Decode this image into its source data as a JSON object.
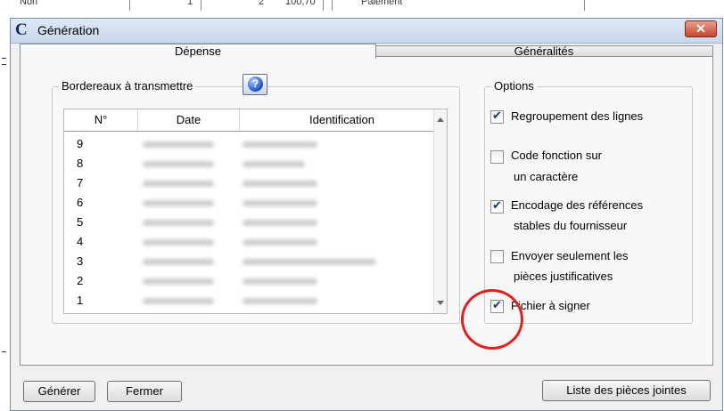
{
  "background": {
    "cells": [
      "Non",
      "1",
      "2",
      "100,70",
      "Paiement"
    ]
  },
  "window": {
    "title": "Génération",
    "close_symbol": "✕",
    "logo_letter": "C"
  },
  "tabs": [
    {
      "label": "Dépense",
      "selected": true
    },
    {
      "label": "Généralités",
      "selected": false
    }
  ],
  "bordereaux": {
    "legend": "Bordereaux à transmettre",
    "help_symbol": "?",
    "columns": [
      "N°",
      "Date",
      "Identification"
    ],
    "rows": [
      {
        "num": "9"
      },
      {
        "num": "8"
      },
      {
        "num": "7"
      },
      {
        "num": "6"
      },
      {
        "num": "5"
      },
      {
        "num": "4"
      },
      {
        "num": "3"
      },
      {
        "num": "2"
      },
      {
        "num": "1"
      }
    ]
  },
  "options": {
    "legend": "Options",
    "items": [
      {
        "line1": "Regroupement des lignes",
        "line2": "",
        "checked": true
      },
      {
        "line1": "Code fonction sur",
        "line2": "un caractère",
        "checked": false
      },
      {
        "line1": "Encodage des références",
        "line2": "stables du fournisseur",
        "checked": true
      },
      {
        "line1": "Envoyer seulement les",
        "line2": "pièces justificatives",
        "checked": false
      },
      {
        "line1": "Fichier à signer",
        "line2": "",
        "checked": true
      }
    ]
  },
  "buttons": {
    "generate": "Générer",
    "close": "Fermer",
    "attachments": "Liste des pièces jointes"
  },
  "colors": {
    "highlight_circle": "#e0201c",
    "title_gradient_top": "#dfe8f5"
  }
}
